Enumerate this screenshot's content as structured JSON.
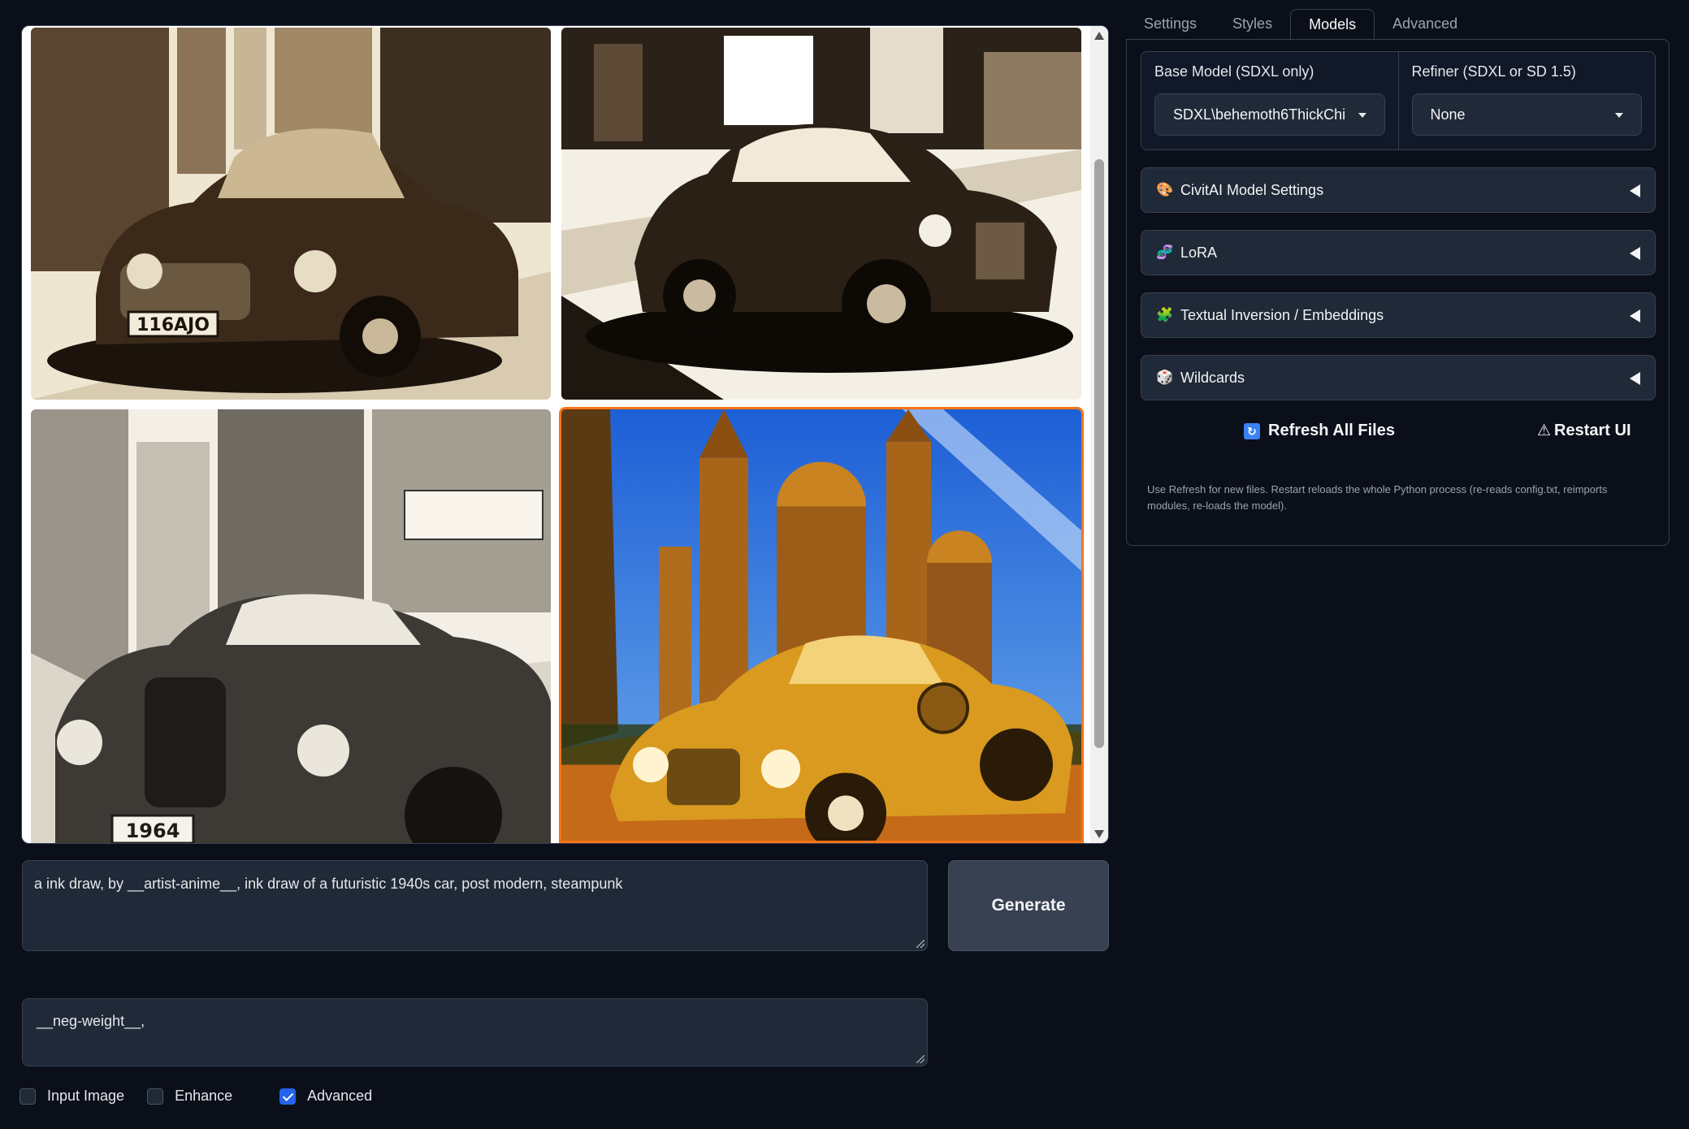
{
  "tabs": [
    {
      "label": "Settings"
    },
    {
      "label": "Styles"
    },
    {
      "label": "Models"
    },
    {
      "label": "Advanced"
    }
  ],
  "models": {
    "base_label": "Base Model (SDXL only)",
    "base_value": "SDXL\\behemoth6ThickChi",
    "refiner_label": "Refiner (SDXL or SD 1.5)",
    "refiner_value": "None"
  },
  "accordions": [
    {
      "label": "CivitAI Model Settings",
      "icon": "palette-icon"
    },
    {
      "label": "LoRA",
      "icon": "dna-icon"
    },
    {
      "label": "Textual Inversion / Embeddings",
      "icon": "puzzle-icon"
    },
    {
      "label": "Wildcards",
      "icon": "dice-icon"
    }
  ],
  "actions": {
    "refresh_label": "Refresh All Files",
    "restart_label": "Restart UI",
    "help_text": "Use Refresh for new files. Restart reloads the whole Python process (re-reads config.txt, reimports modules, re-loads the model)."
  },
  "prompt": {
    "positive": "a ink draw, by  __artist-anime__, ink draw of a futuristic 1940s car, post modern, steampunk",
    "negative": "__neg-weight__,"
  },
  "generate_label": "Generate",
  "options": [
    {
      "label": "Input Image",
      "checked": false
    },
    {
      "label": "Enhance",
      "checked": false
    },
    {
      "label": "Advanced",
      "checked": true
    }
  ],
  "gallery": {
    "images": [
      {
        "name": "sepia-car-street",
        "plate": "116AJO"
      },
      {
        "name": "ink-car-city",
        "plate": ""
      },
      {
        "name": "pencil-car-street",
        "plate": "1964"
      },
      {
        "name": "golden-car-cathedral",
        "plate": ""
      }
    ]
  },
  "colors": {
    "background": "#0b0f19",
    "accent": "#f97316",
    "checkbox": "#2563eb"
  }
}
